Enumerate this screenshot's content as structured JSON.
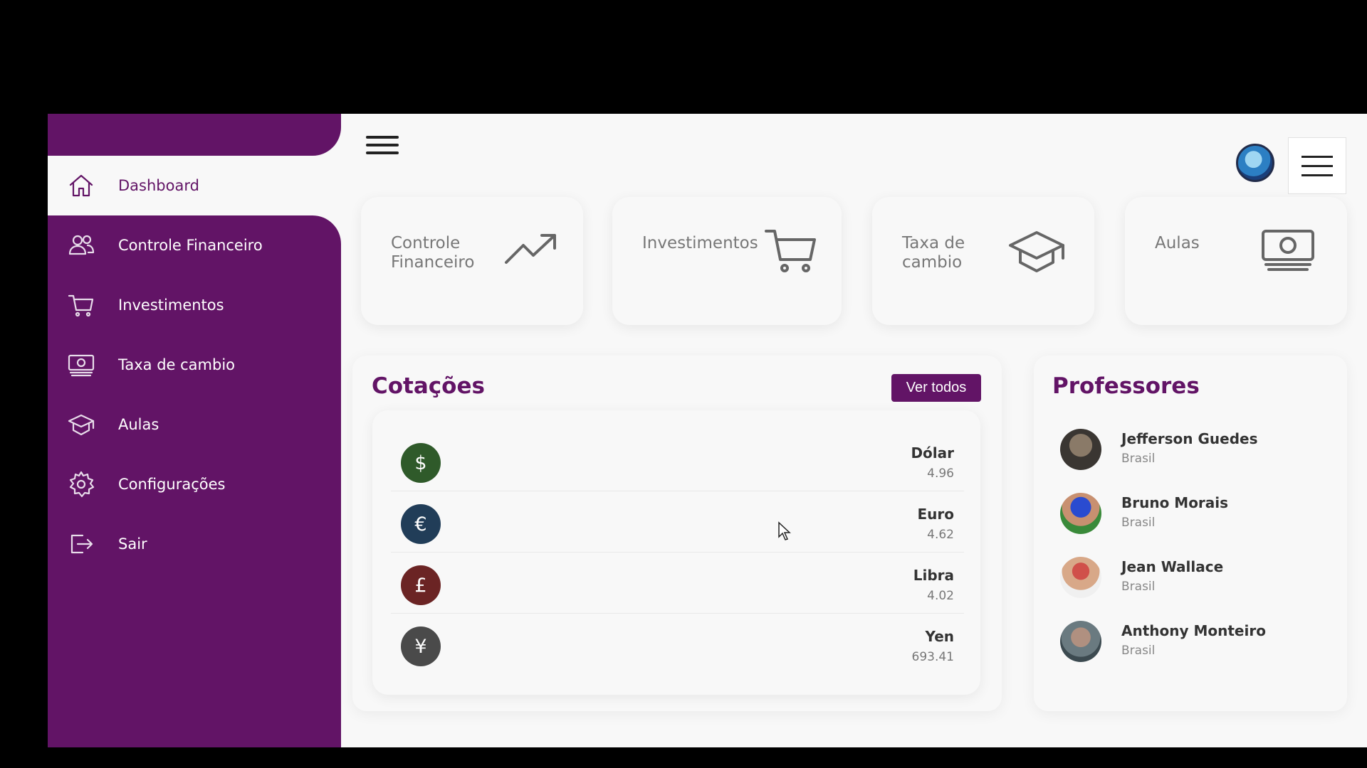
{
  "sidebar": {
    "items": [
      {
        "label": "Dashboard",
        "icon": "home-icon",
        "active": true
      },
      {
        "label": "Controle Financeiro",
        "icon": "users-icon",
        "active": false
      },
      {
        "label": "Investimentos",
        "icon": "cart-icon",
        "active": false
      },
      {
        "label": "Taxa de cambio",
        "icon": "money-icon",
        "active": false
      },
      {
        "label": "Aulas",
        "icon": "graduation-cap-icon",
        "active": false
      },
      {
        "label": "Configurações",
        "icon": "gear-icon",
        "active": false
      },
      {
        "label": "Sair",
        "icon": "logout-icon",
        "active": false
      }
    ]
  },
  "cards": [
    {
      "title": "Controle Financeiro",
      "icon": "trending-up-icon"
    },
    {
      "title": "Investimentos",
      "icon": "cart-icon"
    },
    {
      "title": "Taxa de cambio",
      "icon": "graduation-cap-icon"
    },
    {
      "title": "Aulas",
      "icon": "money-icon"
    }
  ],
  "quotes": {
    "title": "Cotações",
    "view_all_label": "Ver todos",
    "items": [
      {
        "symbol": "$",
        "name": "Dólar",
        "value": "4.96",
        "color": "#2f5a2a"
      },
      {
        "symbol": "€",
        "name": "Euro",
        "value": "4.62",
        "color": "#213d58"
      },
      {
        "symbol": "£",
        "name": "Libra",
        "value": "4.02",
        "color": "#6b2424"
      },
      {
        "symbol": "¥",
        "name": "Yen",
        "value": "693.41",
        "color": "#4a4a4a"
      }
    ]
  },
  "teachers": {
    "title": "Professores",
    "items": [
      {
        "name": "Jefferson Guedes",
        "country": "Brasil"
      },
      {
        "name": "Bruno Morais",
        "country": "Brasil"
      },
      {
        "name": "Jean Wallace",
        "country": "Brasil"
      },
      {
        "name": "Anthony Monteiro",
        "country": "Brasil"
      }
    ]
  },
  "colors": {
    "brand": "#621466",
    "background": "#f8f8f8"
  }
}
